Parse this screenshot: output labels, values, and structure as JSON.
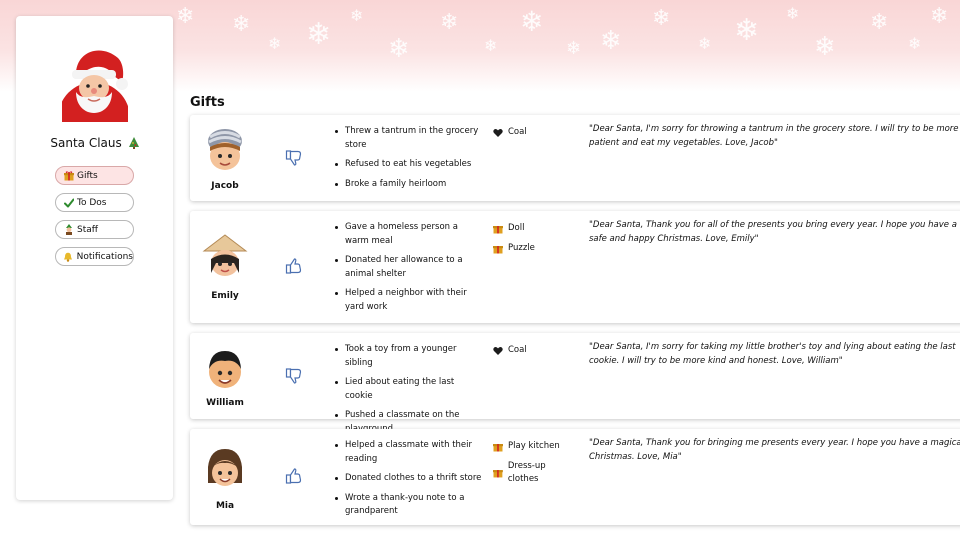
{
  "app": {
    "user_name": "Santa Claus",
    "accent_color": "#fde4e4",
    "banner_color": "#f9d6d6"
  },
  "nav": {
    "items": [
      {
        "label": "Gifts",
        "icon": "gift-icon",
        "active": true
      },
      {
        "label": "To Dos",
        "icon": "checkmark-icon",
        "active": false
      },
      {
        "label": "Staff",
        "icon": "elf-icon",
        "active": false
      },
      {
        "label": "Notifications",
        "icon": "bell-icon",
        "active": false
      }
    ]
  },
  "main": {
    "title": "Gifts",
    "kids": [
      {
        "name": "Jacob",
        "rating": "thumbs-down",
        "deeds": [
          "Threw a tantrum in the grocery store",
          "Refused to eat his vegetables",
          "Broke a family heirloom"
        ],
        "gifts": [
          {
            "label": "Coal",
            "icon": "coal-heart-icon"
          }
        ],
        "letter": "\"Dear Santa, I'm sorry for throwing a tantrum in the grocery store. I will try to be more patient and eat my vegetables. Love, Jacob\""
      },
      {
        "name": "Emily",
        "rating": "thumbs-up",
        "deeds": [
          "Gave a homeless person a warm meal",
          "Donated her allowance to a animal shelter",
          "Helped a neighbor with their yard work"
        ],
        "gifts": [
          {
            "label": "Doll",
            "icon": "gift-icon"
          },
          {
            "label": "Puzzle",
            "icon": "gift-icon"
          }
        ],
        "letter": "\"Dear Santa, Thank you for all of the presents you bring every year. I hope you have a safe and happy Christmas. Love, Emily\""
      },
      {
        "name": "William",
        "rating": "thumbs-down",
        "deeds": [
          "Took a toy from a younger sibling",
          "Lied about eating the last cookie",
          "Pushed a classmate on the playground"
        ],
        "gifts": [
          {
            "label": "Coal",
            "icon": "coal-heart-icon"
          }
        ],
        "letter": "\"Dear Santa, I'm sorry for taking my little brother's toy and lying about eating the last cookie. I will try to be more kind and honest. Love, William\""
      },
      {
        "name": "Mia",
        "rating": "thumbs-up",
        "deeds": [
          "Helped a classmate with their reading",
          "Donated clothes to a thrift store",
          "Wrote a thank-you note to a grandparent"
        ],
        "gifts": [
          {
            "label": "Play kitchen",
            "icon": "gift-icon"
          },
          {
            "label": "Dress-up clothes",
            "icon": "gift-icon"
          }
        ],
        "letter": "\"Dear Santa, Thank you for bringing me presents every year. I hope you have a magical Christmas. Love, Mia\""
      }
    ]
  }
}
